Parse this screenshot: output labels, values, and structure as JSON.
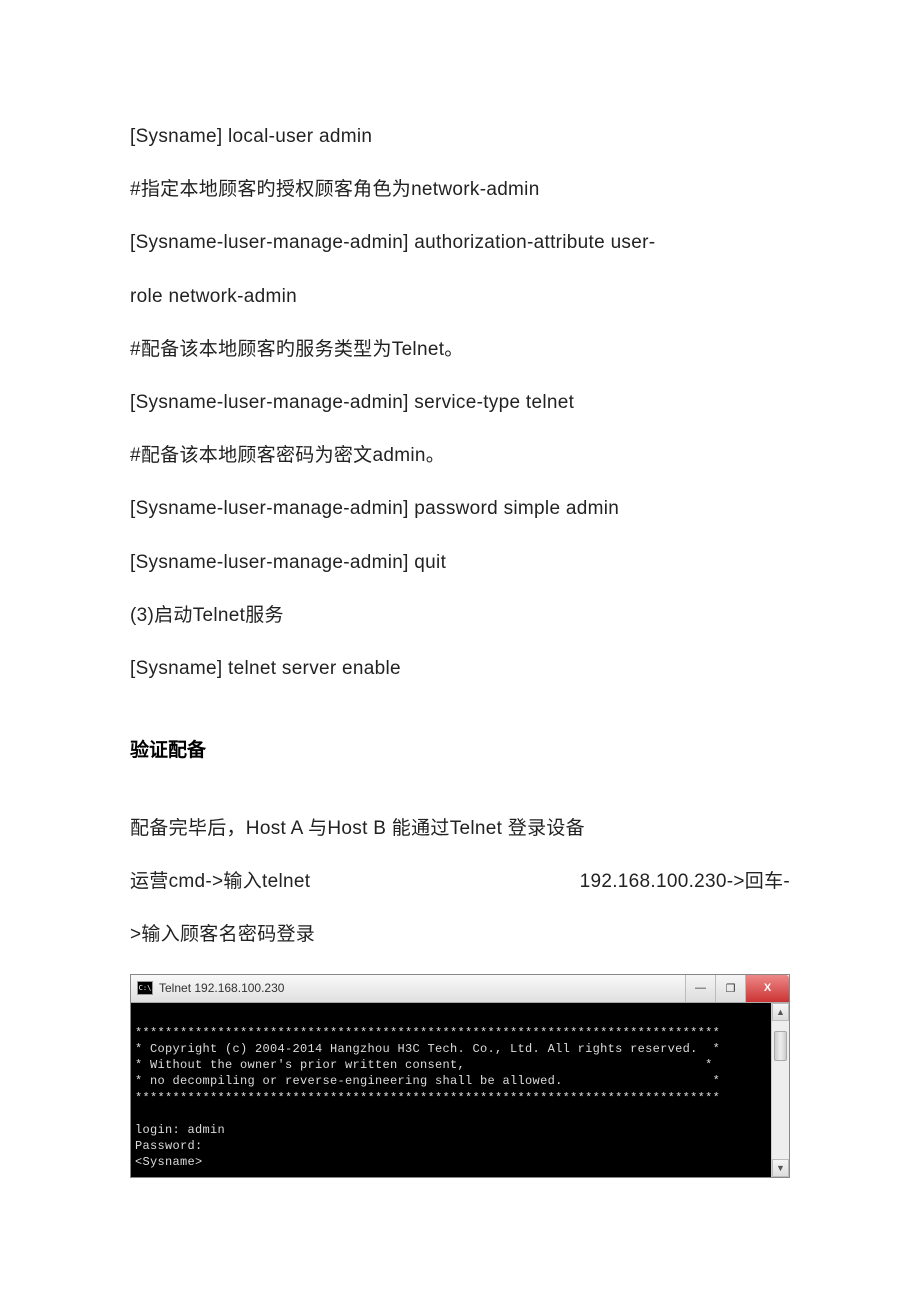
{
  "doc": {
    "lines": [
      "[Sysname] local-user admin",
      "#指定本地顾客旳授权顾客角色为network-admin",
      "[Sysname-luser-manage-admin]  authorization-attribute  user-",
      "role network-admin",
      "#配备该本地顾客旳服务类型为Telnet。",
      "[Sysname-luser-manage-admin] service-type telnet",
      "#配备该本地顾客密码为密文admin。",
      "[Sysname-luser-manage-admin] password simple admin",
      "[Sysname-luser-manage-admin] quit",
      "(3)启动Telnet服务",
      "[Sysname] telnet server enable"
    ],
    "section_title": "验证配备",
    "after_lines": [
      "配备完毕后，Host A 与Host B 能通过Telnet 登录设备"
    ],
    "split_line": {
      "left": "运营cmd->输入telnet",
      "right": "192.168.100.230->回车-"
    },
    "after_lines2": [
      ">输入顾客名密码登录"
    ]
  },
  "terminal": {
    "icon_text": "C:\\",
    "title": "Telnet 192.168.100.230",
    "minimize": "—",
    "maximize": "❐",
    "close": "X",
    "scroll_up": "▲",
    "scroll_down": "▼",
    "body_lines": [
      "",
      "******************************************************************************",
      "* Copyright (c) 2004-2014 Hangzhou H3C Tech. Co., Ltd. All rights reserved.  *",
      "* Without the owner's prior written consent,                                *",
      "* no decompiling or reverse-engineering shall be allowed.                    *",
      "******************************************************************************",
      "",
      "login: admin",
      "Password:",
      "<Sysname>"
    ]
  }
}
